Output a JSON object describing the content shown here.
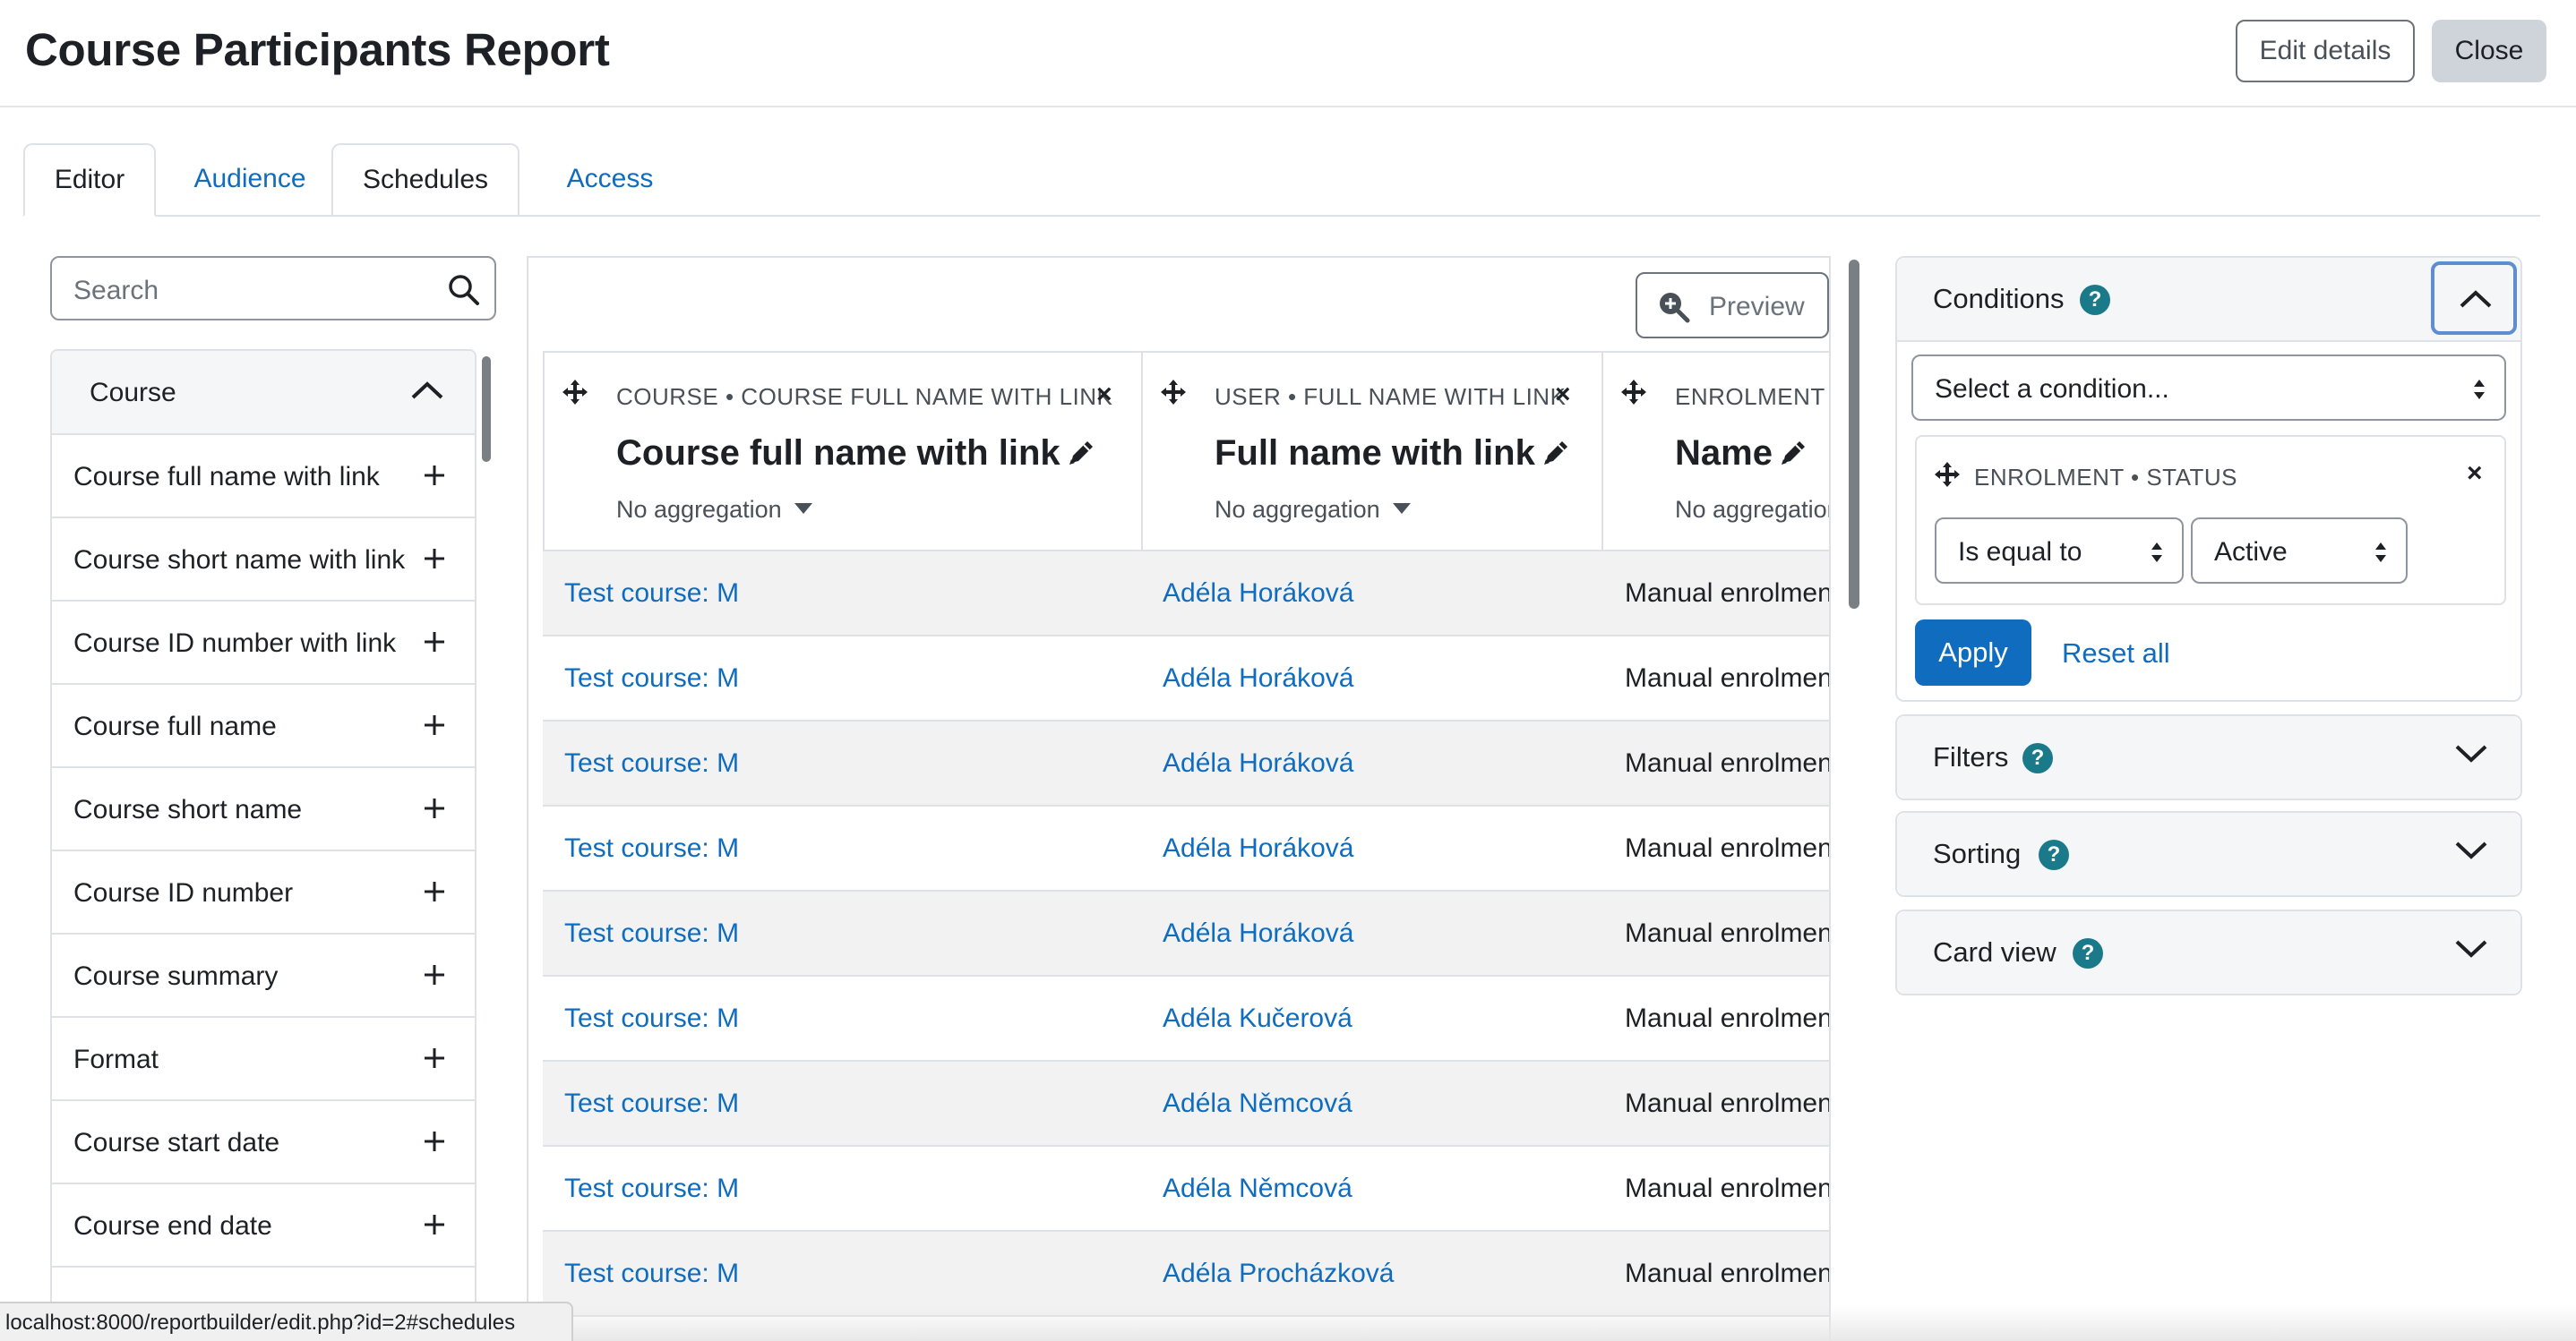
{
  "header": {
    "title": "Course Participants Report",
    "edit_label": "Edit details",
    "close_label": "Close"
  },
  "tabs": [
    {
      "label": "Editor",
      "active": true
    },
    {
      "label": "Audience"
    },
    {
      "label": "Schedules"
    },
    {
      "label": "Access"
    }
  ],
  "sidebar": {
    "search_placeholder": "Search",
    "group_label": "Course",
    "items": [
      "Course full name with link",
      "Course short name with link",
      "Course ID number with link",
      "Course full name",
      "Course short name",
      "Course ID number",
      "Course summary",
      "Format",
      "Course start date",
      "Course end date"
    ]
  },
  "preview_label": "Preview",
  "columns": [
    {
      "caption": "COURSE • COURSE FULL NAME WITH LINK",
      "title": "Course full name with link",
      "aggregation": "No aggregation"
    },
    {
      "caption": "USER • FULL NAME WITH LINK",
      "title": "Full name with link",
      "aggregation": "No aggregation"
    },
    {
      "caption": "ENROLMENT • NAME",
      "title": "Name",
      "aggregation": "No aggregation"
    }
  ],
  "rows": [
    [
      "Test course: M",
      "Adéla Horáková",
      "Manual enrolments"
    ],
    [
      "Test course: M",
      "Adéla Horáková",
      "Manual enrolments"
    ],
    [
      "Test course: M",
      "Adéla Horáková",
      "Manual enrolments"
    ],
    [
      "Test course: M",
      "Adéla Horáková",
      "Manual enrolments"
    ],
    [
      "Test course: M",
      "Adéla Horáková",
      "Manual enrolments"
    ],
    [
      "Test course: M",
      "Adéla Kučerová",
      "Manual enrolments"
    ],
    [
      "Test course: M",
      "Adéla Němcová",
      "Manual enrolments"
    ],
    [
      "Test course: M",
      "Adéla Němcová",
      "Manual enrolments"
    ],
    [
      "Test course: M",
      "Adéla Procházková",
      "Manual enrolments"
    ]
  ],
  "conditions": {
    "title": "Conditions",
    "select_placeholder": "Select a condition...",
    "item_caption": "ENROLMENT • STATUS",
    "operator": "Is equal to",
    "value": "Active",
    "apply_label": "Apply",
    "reset_label": "Reset all"
  },
  "panels": {
    "filters": "Filters",
    "sorting": "Sorting",
    "card_view": "Card view"
  },
  "status_url": "localhost:8000/reportbuilder/edit.php?id=2#schedules",
  "colors": {
    "link": "#0f6cbf",
    "primary": "#0f6cbf",
    "help_badge": "#1a7a8a"
  }
}
